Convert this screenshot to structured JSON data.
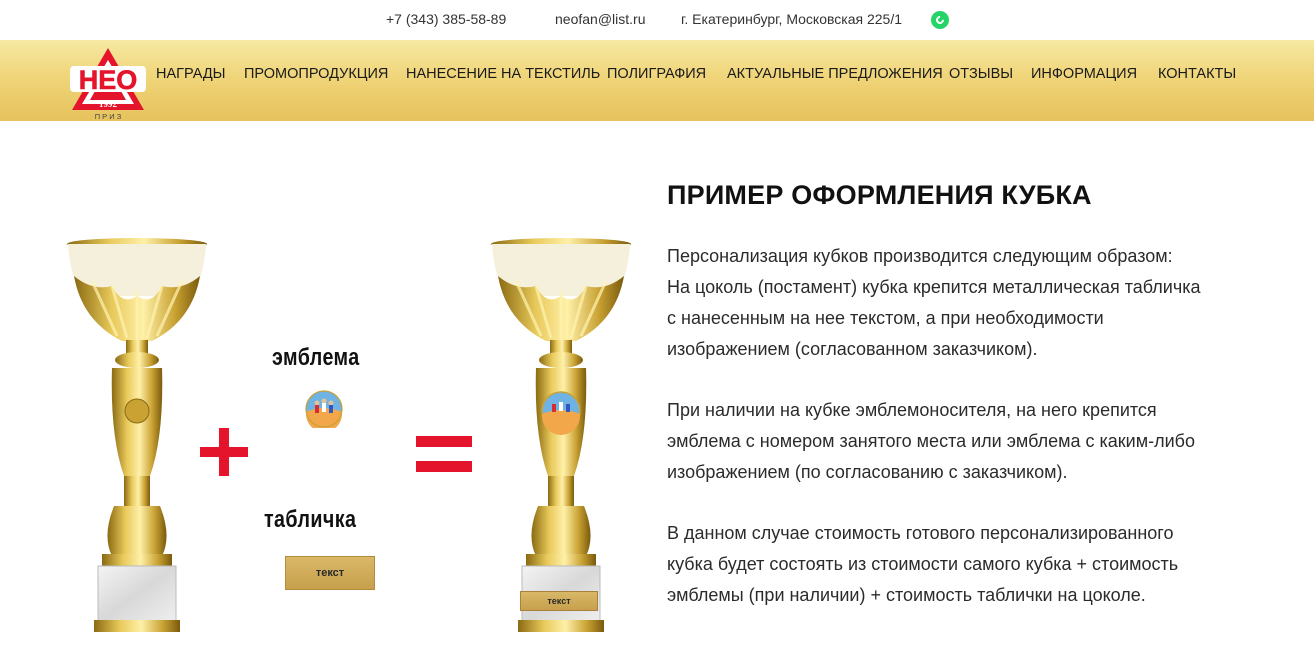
{
  "topbar": {
    "phone": "+7 (343) 385-58-89",
    "email": "neofan@list.ru",
    "address": "г. Екатеринбург, Московская 225/1",
    "messenger_icon": "whatsapp-icon",
    "messenger_color": "#25d366"
  },
  "logo": {
    "text": "НЕО",
    "year": "1992",
    "subtitle": "П Р И З",
    "brand_color": "#e3142b"
  },
  "nav": {
    "items": [
      "НАГРАДЫ",
      "ПРОМОПРОДУКЦИЯ",
      "НАНЕСЕНИЕ НА ТЕКСТИЛЬ",
      "ПОЛИГРАФИЯ",
      "АКТУАЛЬНЫЕ ПРЕДЛОЖЕНИЯ",
      "ОТЗЫВЫ",
      "ИНФОРМАЦИЯ",
      "КОНТАКТЫ"
    ],
    "background": "#f0d57a"
  },
  "illustration": {
    "emblem_label": "эмблема",
    "plaque_label": "табличка",
    "plaque_text": "текст",
    "plaque_small_text": "текст",
    "operator_color": "#e3142b"
  },
  "content": {
    "heading": "ПРИМЕР ОФОРМЛЕНИЯ КУБКА",
    "p1_line1": "Персонализация кубков производится следующим образом:",
    "p1_line2": "На цоколь (постамент) кубка крепится металлическая табличка",
    "p1_line3": "с нанесенным на нее текстом, а при необходимости",
    "p1_line4": "изображением (согласованном заказчиком).",
    "p2_line1": "При наличии на кубке эмблемоносителя, на него крепится",
    "p2_line2": "эмблема с номером занятого места или эмблема с каким-либо",
    "p2_line3": "изображением (по согласованию с заказчиком).",
    "p3_line1": "В данном случае стоимость готового персонализированного",
    "p3_line2": "кубка будет состоять из стоимости самого кубка + стоимость",
    "p3_line3": "эмблемы (при наличии) + стоимость таблички на цоколе."
  }
}
